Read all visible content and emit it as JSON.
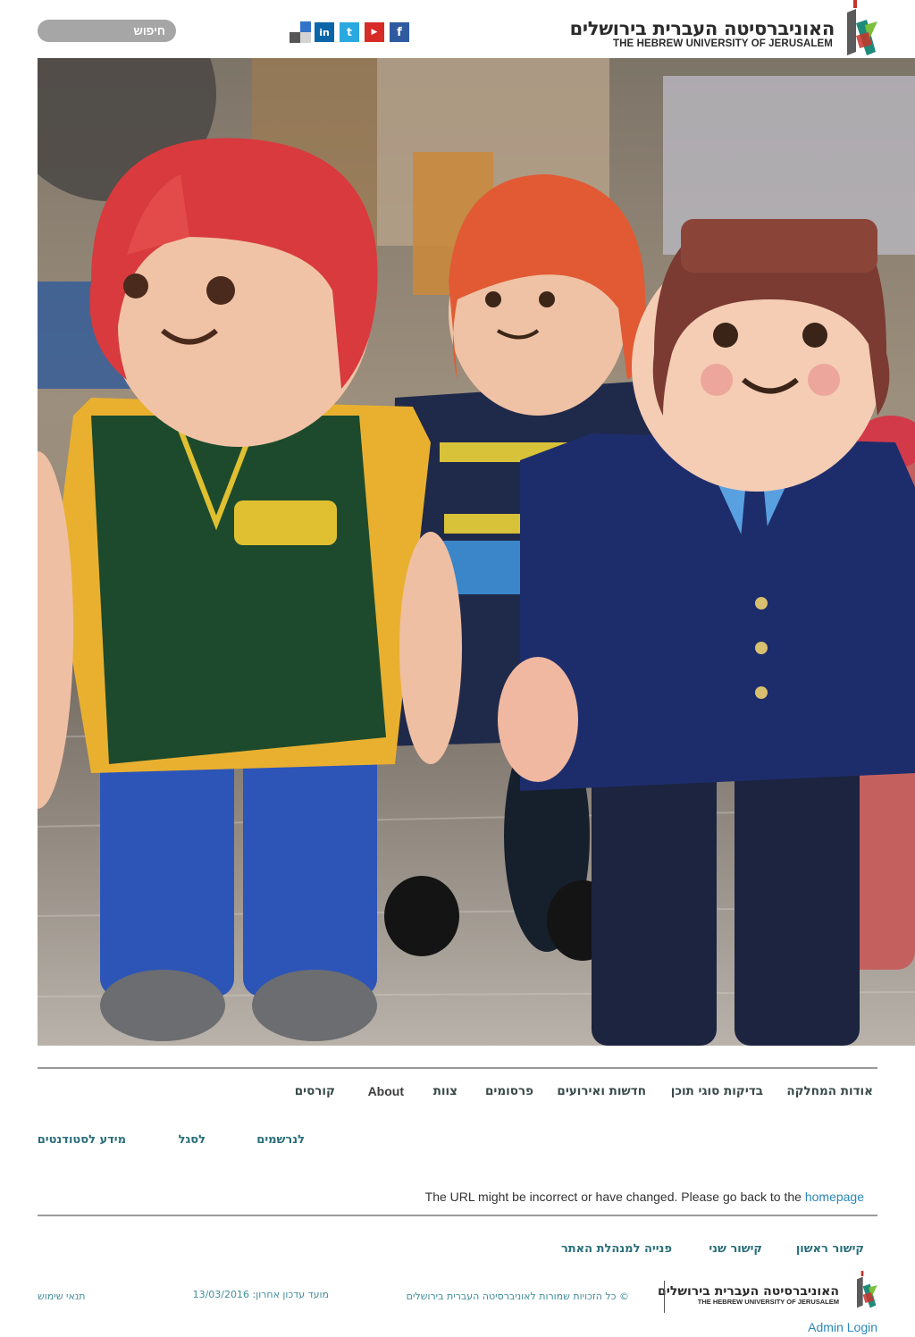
{
  "header": {
    "search_label": "חיפוש",
    "university_name_he": "האוניברסיטה העברית בירושלים",
    "university_name_en": "THE HEBREW UNIVERSITY OF JERUSALEM",
    "social_icons": [
      "delicious-icon",
      "linkedin-icon",
      "twitter-icon",
      "youtube-icon",
      "facebook-icon"
    ],
    "social_glyphs": {
      "linkedin": "in",
      "twitter": "t",
      "youtube": "▶",
      "facebook": "f"
    }
  },
  "main_nav": {
    "items": [
      {
        "label": "אודות המחלקה"
      },
      {
        "label": "בדיקות סוגי תוכן"
      },
      {
        "label": "חדשות ואירועים"
      },
      {
        "label": "פרסומים"
      },
      {
        "label": "צוות"
      },
      {
        "label": "About"
      },
      {
        "label": "קורסים"
      }
    ]
  },
  "sub_nav": {
    "items": [
      {
        "label": "לנרשמים"
      },
      {
        "label": "לסגל"
      },
      {
        "label": "מידע לסטודנטים"
      }
    ]
  },
  "message": {
    "text": "The URL might be incorrect or have changed. Please go back to the",
    "link_text": "homepage"
  },
  "footer": {
    "links": [
      {
        "label": "קישור ראשון"
      },
      {
        "label": "קישור שני"
      },
      {
        "label": "פנייה למנהלת האתר"
      }
    ],
    "copyright": "© כל הזכויות שמורות לאוניברסיטה העברית בירושלים",
    "last_update_label": "מועד עדכון אחרון:",
    "last_update_date": "13/03/2016",
    "terms": "תנאי שימוש",
    "admin_login": "Admin Login"
  },
  "colors": {
    "accent_teal": "#2a6f7a",
    "link_blue": "#2a86b9",
    "search_gray": "#a6a6a6"
  }
}
